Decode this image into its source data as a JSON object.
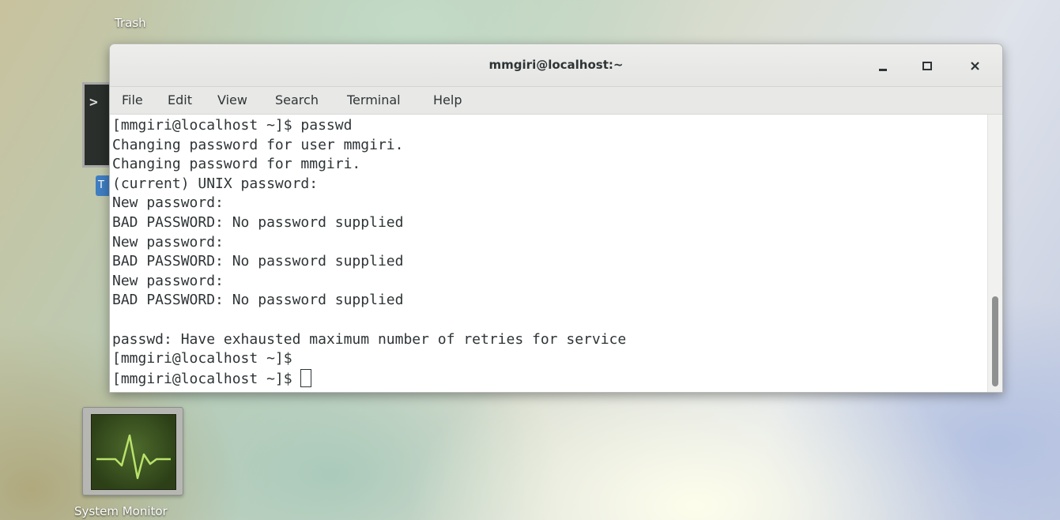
{
  "desktop": {
    "trash_label": "Trash",
    "system_monitor_label": "System Monitor",
    "terminal_icon_prompt": ">",
    "terminal_icon_tag": "T"
  },
  "window": {
    "title": "mmgiri@localhost:~",
    "controls": {
      "minimize": "minimize-icon",
      "maximize": "maximize-icon",
      "close": "close-icon"
    }
  },
  "menu": {
    "items": [
      "File",
      "Edit",
      "View",
      "Search",
      "Terminal",
      "Help"
    ]
  },
  "terminal": {
    "lines": [
      "[mmgiri@localhost ~]$ passwd",
      "Changing password for user mmgiri.",
      "Changing password for mmgiri.",
      "(current) UNIX password:",
      "New password:",
      "BAD PASSWORD: No password supplied",
      "New password:",
      "BAD PASSWORD: No password supplied",
      "New password:",
      "BAD PASSWORD: No password supplied",
      "",
      "passwd: Have exhausted maximum number of retries for service",
      "[mmgiri@localhost ~]$",
      "[mmgiri@localhost ~]$ "
    ]
  },
  "colors": {
    "text": "#2e3436",
    "titlebar": "#e8e8e6",
    "terminal_background": "#ffffff"
  }
}
